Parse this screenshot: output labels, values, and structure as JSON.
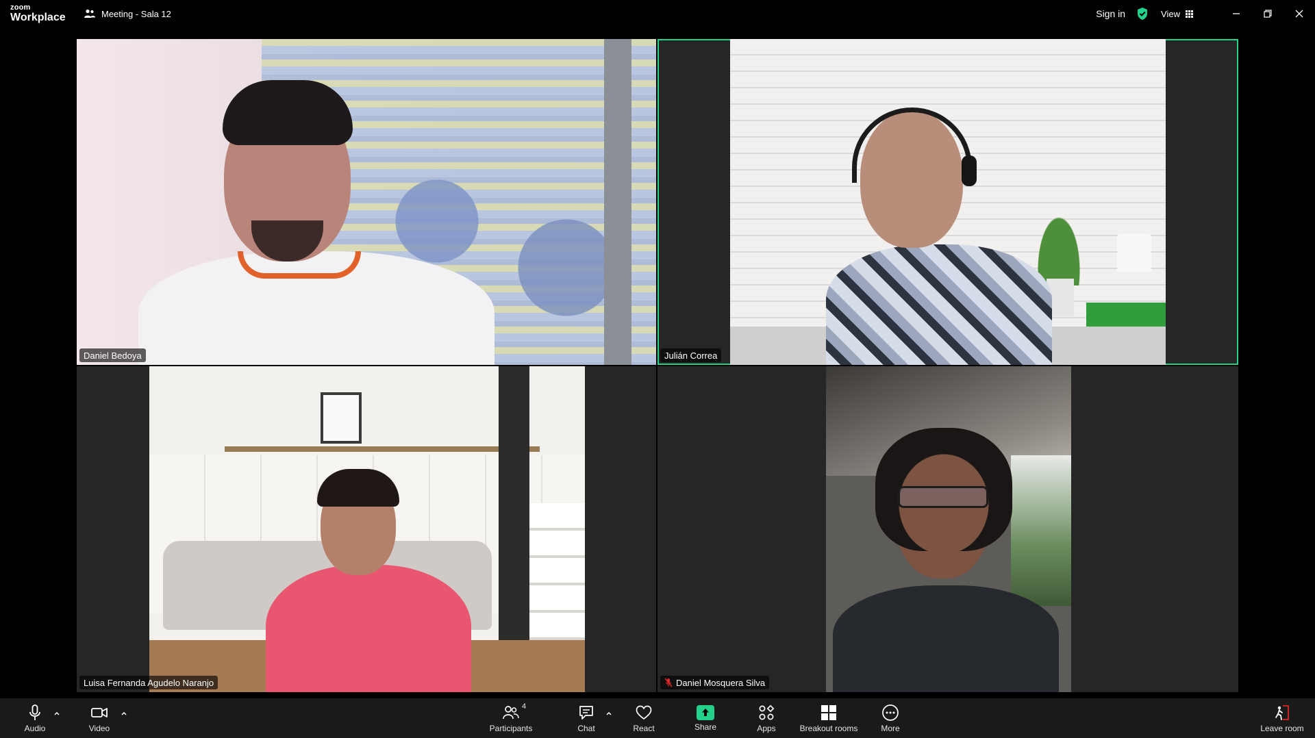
{
  "app": {
    "logo_top": "zoom",
    "logo_bottom": "Workplace",
    "meeting_title": "Meeting - Sala 12",
    "sign_in": "Sign in",
    "view_label": "View"
  },
  "participants": [
    {
      "name": "Daniel Bedoya",
      "active_speaker": false,
      "muted": false
    },
    {
      "name": "Julián Correa",
      "active_speaker": true,
      "muted": false
    },
    {
      "name": "Luisa Fernanda Agudelo Naranjo",
      "active_speaker": false,
      "muted": false
    },
    {
      "name": "Daniel Mosquera Silva",
      "active_speaker": false,
      "muted": true
    }
  ],
  "toolbar": {
    "audio": "Audio",
    "video": "Video",
    "participants": "Participants",
    "participants_count": "4",
    "chat": "Chat",
    "react": "React",
    "share": "Share",
    "apps": "Apps",
    "breakout_rooms": "Breakout rooms",
    "more": "More",
    "leave_room": "Leave room"
  },
  "colors": {
    "active_speaker_border": "#23d18b",
    "share_accent": "#23d18b",
    "muted_red": "#e02828",
    "leave_red": "#e02828"
  },
  "icons": [
    "people-icon",
    "shield-check-icon",
    "grid-icon",
    "minimize-icon",
    "restore-icon",
    "close-icon",
    "microphone-icon",
    "camera-icon",
    "participants-icon",
    "chat-icon",
    "heart-icon",
    "share-up-arrow-icon",
    "apps-icon",
    "breakout-rooms-icon",
    "more-dots-icon",
    "leave-icon",
    "muted-mic-icon"
  ]
}
